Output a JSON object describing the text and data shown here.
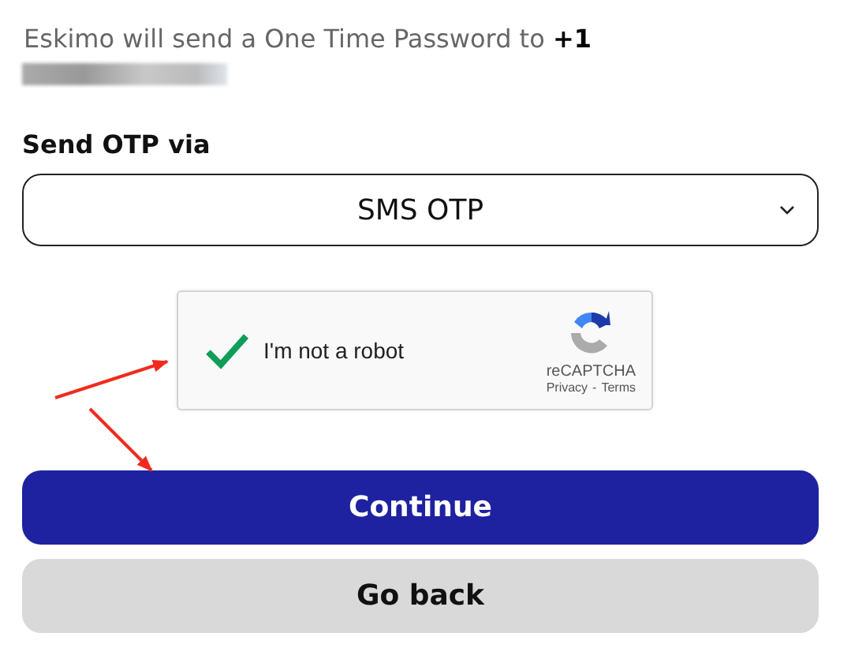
{
  "message": "Eskimo will send a One Time Password to **+1**",
  "otp": {
    "label": "Send OTP via",
    "value": "SMS OTP"
  },
  "captcha": {
    "label": "I'm not a robot",
    "checked": true,
    "brand": "reCAPTCHA",
    "privacy": "Privacy",
    "separator": "-",
    "terms": "Terms"
  },
  "buttons": [
    {
      "label": "Continue",
      "kind": "primary"
    },
    {
      "label": "Go back",
      "kind": "secondary"
    }
  ]
}
